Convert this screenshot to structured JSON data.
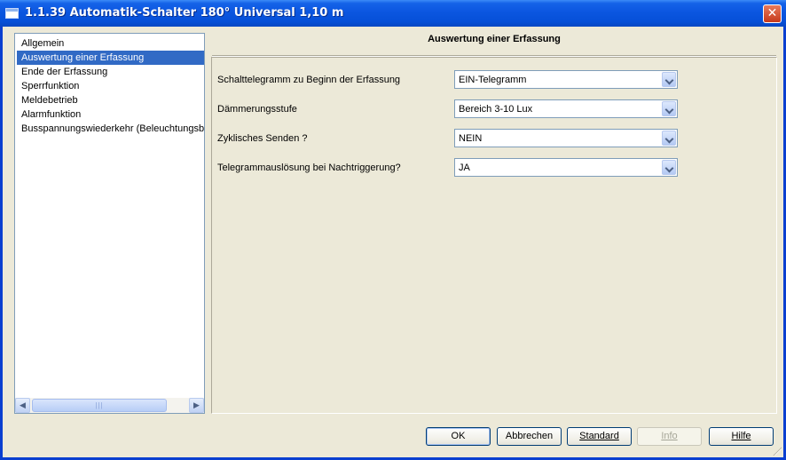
{
  "window": {
    "title": "1.1.39 Automatik-Schalter 180° Universal 1,10 m",
    "close_label": "✕"
  },
  "nav": {
    "items": [
      {
        "label": "Allgemein",
        "selected": false
      },
      {
        "label": "Auswertung einer Erfassung",
        "selected": true
      },
      {
        "label": "Ende der Erfassung",
        "selected": false
      },
      {
        "label": "Sperrfunktion",
        "selected": false
      },
      {
        "label": "Meldebetrieb",
        "selected": false
      },
      {
        "label": "Alarmfunktion",
        "selected": false
      },
      {
        "label": "Busspannungswiederkehr (Beleuchtungsbe",
        "selected": false
      }
    ],
    "scroll_left": "◀",
    "scroll_right": "▶",
    "thumb_grip": "|||"
  },
  "panel": {
    "heading": "Auswertung einer Erfassung",
    "params": [
      {
        "label": "Schalttelegramm zu Beginn der Erfassung",
        "value": "EIN-Telegramm"
      },
      {
        "label": "Dämmerungsstufe",
        "value": "Bereich 3-10 Lux"
      },
      {
        "label": "Zyklisches Senden ?",
        "value": "NEIN"
      },
      {
        "label": "Telegrammauslösung bei Nachtriggerung?",
        "value": "JA"
      }
    ]
  },
  "buttons": {
    "ok": "OK",
    "cancel": "Abbrechen",
    "standard": "Standard",
    "info": "Info",
    "help": "Hilfe"
  }
}
